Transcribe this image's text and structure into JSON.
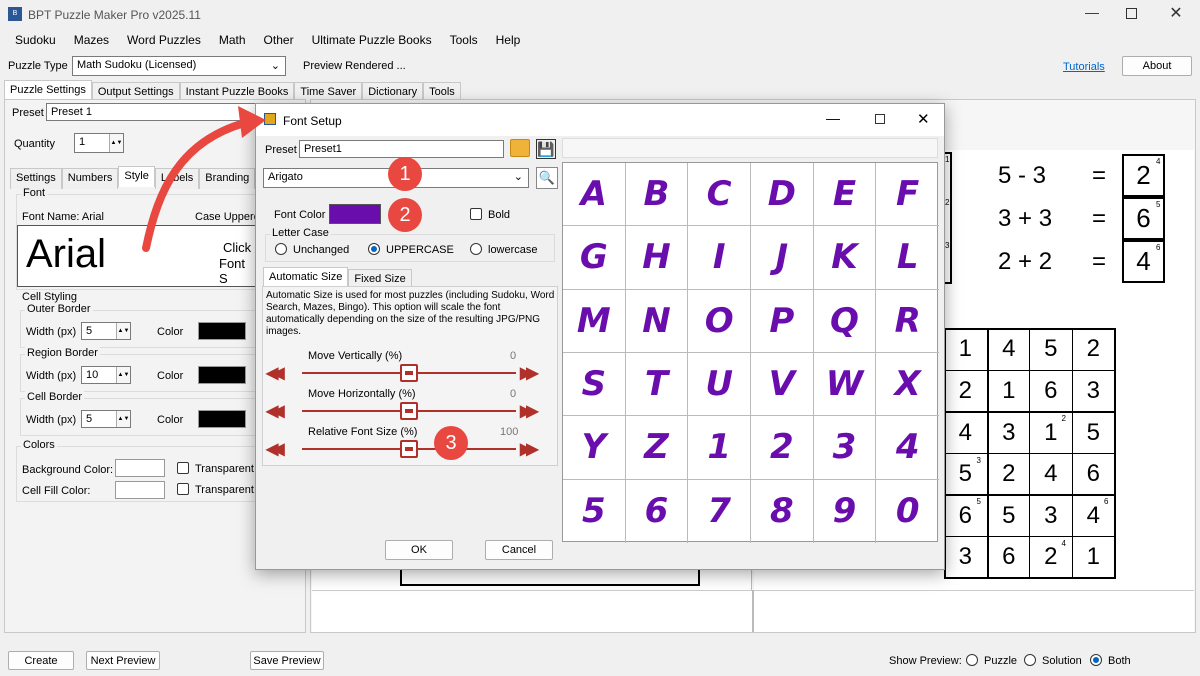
{
  "app": {
    "title": "BPT Puzzle Maker Pro v2025.11"
  },
  "menu": [
    "Sudoku",
    "Mazes",
    "Word Puzzles",
    "Math",
    "Other",
    "Ultimate Puzzle Books",
    "Tools",
    "Help"
  ],
  "toolbar": {
    "puzzle_type_label": "Puzzle Type",
    "puzzle_type_value": "Math Sudoku (Licensed)",
    "preview_status": "Preview Rendered ...",
    "tutorials": "Tutorials",
    "about": "About"
  },
  "main_tabs": [
    "Puzzle Settings",
    "Output Settings",
    "Instant Puzzle Books",
    "Time Saver",
    "Dictionary",
    "Tools"
  ],
  "left": {
    "preset_label": "Preset",
    "preset_value": "Preset 1",
    "quantity_label": "Quantity",
    "quantity_value": "1",
    "sub_tabs": [
      "Settings",
      "Numbers",
      "Style",
      "Labels",
      "Branding"
    ],
    "font_group": "Font",
    "font_name_label": "Font Name: Arial",
    "case_label": "Case Upperc",
    "font_preview": "Arial",
    "click_hint": "Click",
    "click_hint2": "Font S",
    "cell_styling": "Cell Styling",
    "outer_border": "Outer Border",
    "region_border": "Region Border",
    "cell_border": "Cell Border",
    "width_label": "Width (px)",
    "color_label": "Color",
    "outer_width": "5",
    "region_width": "10",
    "cell_width": "5",
    "colors_group": "Colors",
    "bg_color_label": "Background Color:",
    "cell_fill_label": "Cell Fill Color:",
    "transparent": "Transparent"
  },
  "dialog": {
    "title": "Font Setup",
    "preset_label": "Preset",
    "preset_value": "Preset1",
    "font_value": "Arigato",
    "font_color_label": "Font Color",
    "font_color": "#6a0dad",
    "bold_label": "Bold",
    "letter_case_group": "Letter Case",
    "case_options": [
      "Unchanged",
      "UPPERCASE",
      "lowercase"
    ],
    "size_tabs": [
      "Automatic Size",
      "Fixed Size"
    ],
    "auto_desc": "Automatic Size is used for most puzzles (including Sudoku, Word Search, Mazes, Bingo). This option will scale the font automatically depending on the size of the resulting JPG/PNG images.",
    "sliders": [
      {
        "label": "Move Vertically (%)",
        "value": "0",
        "level": 0.5
      },
      {
        "label": "Move Horizontally (%)",
        "value": "0",
        "level": 0.5
      },
      {
        "label": "Relative Font Size (%)",
        "value": "100",
        "level": 0.5
      }
    ],
    "ok": "OK",
    "cancel": "Cancel",
    "glyphs": [
      "A",
      "B",
      "C",
      "D",
      "E",
      "F",
      "G",
      "H",
      "I",
      "J",
      "K",
      "L",
      "M",
      "N",
      "O",
      "P",
      "Q",
      "R",
      "S",
      "T",
      "U",
      "V",
      "W",
      "X",
      "Y",
      "Z",
      "1",
      "2",
      "3",
      "4",
      "5",
      "6",
      "7",
      "8",
      "9",
      "0"
    ]
  },
  "badges": [
    "1",
    "2",
    "3"
  ],
  "equations": [
    {
      "expr": "5 - 3",
      "eq": "=",
      "ans": "2",
      "sup": "4"
    },
    {
      "expr": "3 + 3",
      "eq": "=",
      "ans": "6",
      "sup": "5"
    },
    {
      "expr": "2 + 2",
      "eq": "=",
      "ans": "4",
      "sup": "6"
    }
  ],
  "grid_rows": [
    [
      "1",
      "4",
      "5",
      "2"
    ],
    [
      "2",
      "1",
      "6",
      "3"
    ],
    [
      "4",
      "3",
      "1",
      "5"
    ],
    [
      "5",
      "2",
      "4",
      "6"
    ],
    [
      "6",
      "5",
      "3",
      "4"
    ],
    [
      "3",
      "6",
      "2",
      "1"
    ]
  ],
  "grid_sups": [
    "2",
    "3",
    "5",
    "6",
    "4"
  ],
  "left_sups": [
    "1",
    "2",
    "3"
  ],
  "bottom": {
    "create": "Create",
    "next_preview": "Next Preview",
    "save_preview": "Save Preview",
    "show_preview": "Show Preview:",
    "options": [
      "Puzzle",
      "Solution",
      "Both"
    ]
  }
}
